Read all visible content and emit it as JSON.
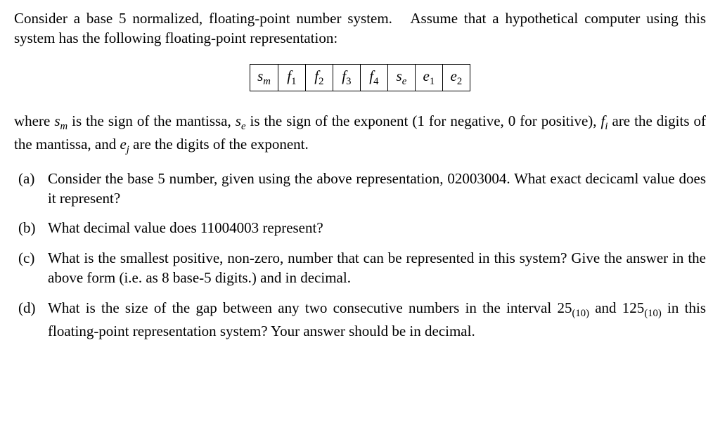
{
  "intro": {
    "line1_a": "Consider a base 5 normalized, floating-point number system.",
    "line1_b": "Assume that a hypothetical computer using this system has the following floating-point representation:"
  },
  "cells": [
    {
      "var": "s",
      "sub": "m"
    },
    {
      "var": "f",
      "sub": "1"
    },
    {
      "var": "f",
      "sub": "2"
    },
    {
      "var": "f",
      "sub": "3"
    },
    {
      "var": "f",
      "sub": "4"
    },
    {
      "var": "s",
      "sub": "e"
    },
    {
      "var": "e",
      "sub": "1"
    },
    {
      "var": "e",
      "sub": "2"
    }
  ],
  "where": {
    "t1": "where ",
    "sm_v": "s",
    "sm_s": "m",
    "t2": " is the sign of the mantissa, ",
    "se_v": "s",
    "se_s": "e",
    "t3": " is the sign of the exponent (1 for negative, 0 for positive), ",
    "fi_v": "f",
    "fi_s": "i",
    "t4": " are the digits of the mantissa, and ",
    "ej_v": "e",
    "ej_s": "j",
    "t5": " are the digits of the exponent."
  },
  "items": {
    "a": {
      "label": "(a)",
      "text": "Consider the base 5 number, given using the above representation, 02003004. What exact decicaml value does it represent?"
    },
    "b": {
      "label": "(b)",
      "text": "What decimal value does 11004003 represent?"
    },
    "c": {
      "label": "(c)",
      "text": "What is the smallest positive, non-zero, number that can be represented in this system? Give the answer in the above form (i.e. as 8 base-5 digits.) and in decimal."
    },
    "d": {
      "label": "(d)",
      "t1": "What is the size of the gap between any two consecutive numbers in the interval 25",
      "sub1": "(10)",
      "t2": " and 125",
      "sub2": "(10)",
      "t3": " in this floating-point representation system?  Your answer should be in decimal."
    }
  }
}
